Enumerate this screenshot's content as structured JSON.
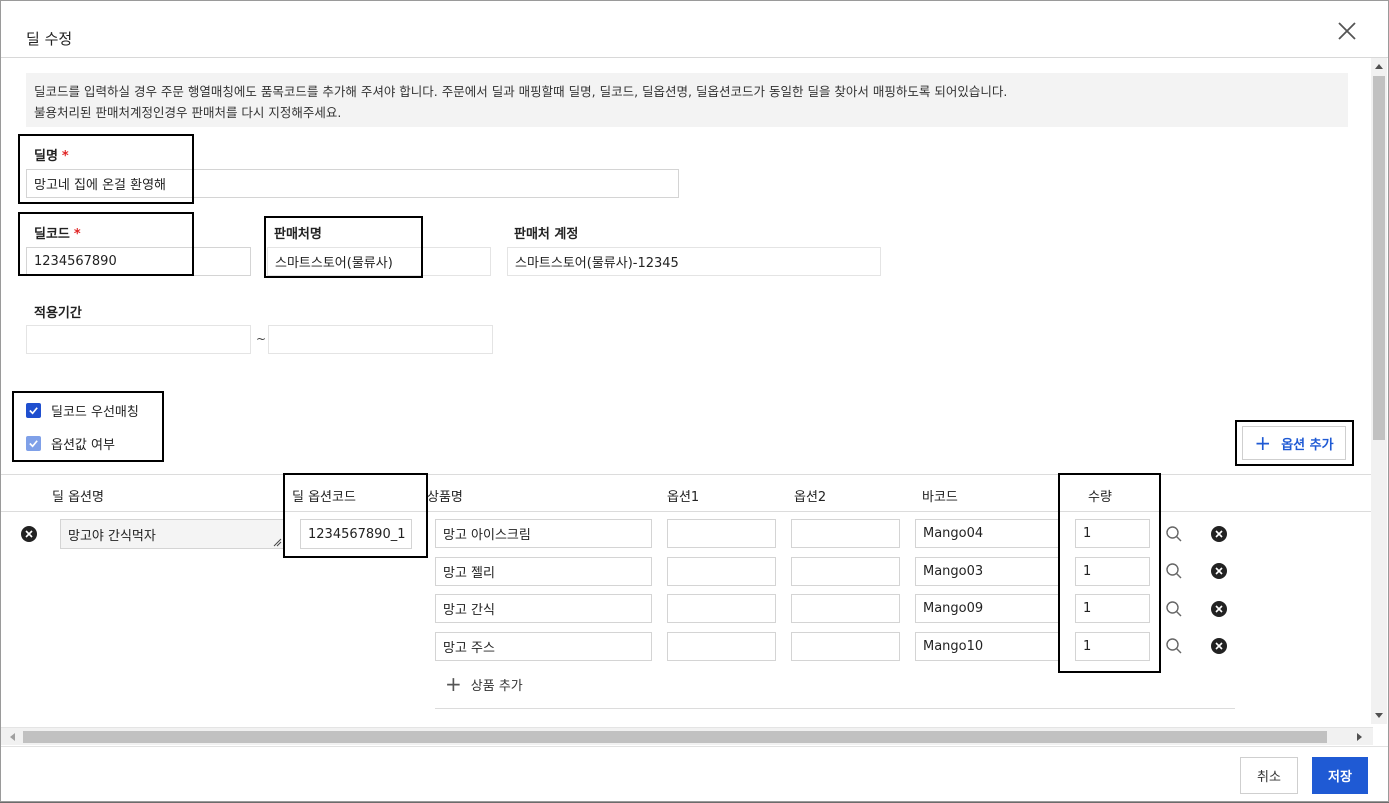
{
  "dialog": {
    "title": "딜 수정"
  },
  "notice": {
    "line1": "딜코드를 입력하실 경우 주문 행열매칭에도 품목코드를 추가해 주셔야 합니다. 주문에서 딜과 매핑할때 딜명, 딜코드, 딜옵션명, 딜옵션코드가 동일한 딜을 찾아서 매핑하도록 되어있습니다.",
    "line2": "불용처리된 판매처계정인경우 판매처를 다시 지정해주세요."
  },
  "form": {
    "deal_name_label": "딜명",
    "deal_name_value": "망고네 집에 온걸 환영해",
    "deal_code_label": "딜코드",
    "deal_code_value": "1234567890",
    "seller_name_label": "판매처명",
    "seller_name_value": "스마트스토어(물류사)",
    "seller_account_label": "판매처 계정",
    "seller_account_value": "스마트스토어(물류사)-12345",
    "period_label": "적용기간",
    "period_start": "",
    "period_end": "",
    "period_sep": "~",
    "required_mark": "*"
  },
  "checkboxes": [
    {
      "label": "딜코드 우선매칭",
      "checked": true,
      "color": "#1f4fcf"
    },
    {
      "label": "옵션값 여부",
      "checked": true,
      "color": "#7fa0e8"
    }
  ],
  "add_option_button": "옵션 추가",
  "table": {
    "headers": {
      "option_name": "딜 옵션명",
      "option_code": "딜 옵션코드",
      "product_name": "상품명",
      "option1": "옵션1",
      "option2": "옵션2",
      "barcode": "바코드",
      "quantity": "수량"
    },
    "option_row": {
      "option_name": "망고야 간식먹자",
      "option_code": "1234567890_1"
    },
    "products": [
      {
        "name": "망고 아이스크림",
        "option1": "",
        "option2": "",
        "barcode": "Mango04",
        "quantity": "1"
      },
      {
        "name": "망고 젤리",
        "option1": "",
        "option2": "",
        "barcode": "Mango03",
        "quantity": "1"
      },
      {
        "name": "망고 간식",
        "option1": "",
        "option2": "",
        "barcode": "Mango09",
        "quantity": "1"
      },
      {
        "name": "망고 주스",
        "option1": "",
        "option2": "",
        "barcode": "Mango10",
        "quantity": "1"
      }
    ],
    "add_product": "상품 추가"
  },
  "footer": {
    "cancel": "취소",
    "save": "저장"
  },
  "colors": {
    "primary": "#1f5ad4",
    "required": "#e02424"
  }
}
